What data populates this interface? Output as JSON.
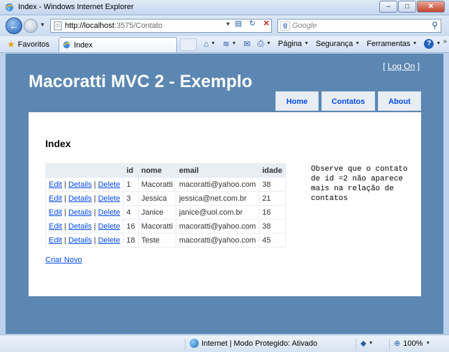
{
  "window": {
    "title": "Index - Windows Internet Explorer",
    "min": "–",
    "max": "□",
    "close": "✕"
  },
  "address": {
    "url_host": "http://localhost",
    "url_rest": ":3575/Contato",
    "search_placeholder": "Google",
    "search_logo": "g"
  },
  "toolbar": {
    "favorites": "Favoritos",
    "tab_title": "Index",
    "pagina": "Página",
    "seguranca": "Segurança",
    "ferramentas": "Ferramentas",
    "help": "?"
  },
  "site": {
    "login_open": "[",
    "login_label": "Log On",
    "login_close": "]",
    "title": "Macoratti MVC 2 - Exemplo",
    "menu": {
      "home": "Home",
      "contatos": "Contatos",
      "about": "About"
    }
  },
  "page": {
    "heading": "Index",
    "columns": [
      "",
      "id",
      "nome",
      "email",
      "idade"
    ],
    "action_labels": {
      "edit": "Edit",
      "details": "Details",
      "delete": "Delete",
      "sep": "|"
    },
    "rows": [
      {
        "id": "1",
        "nome": "Macoratti",
        "email": "macoratti@yahoo.com",
        "idade": "38"
      },
      {
        "id": "3",
        "nome": "Jessica",
        "email": "jessica@net.com.br",
        "idade": "21"
      },
      {
        "id": "4",
        "nome": "Janice",
        "email": "janice@uol.com.br",
        "idade": "16"
      },
      {
        "id": "16",
        "nome": "Macoratti",
        "email": "macoratti@yahoo.com",
        "idade": "38"
      },
      {
        "id": "18",
        "nome": "Teste",
        "email": "macoratti@yahoo.com",
        "idade": "45"
      }
    ],
    "note": "Observe que o contato de id =2 não aparece mais na relação de contatos",
    "create_link": "Criar Novo"
  },
  "status": {
    "zone": "Internet | Modo Protegido: Ativado",
    "zoom": "100%"
  },
  "colors": {
    "page_bg": "#5c87b2",
    "link": "#034af3",
    "menu_bg": "#e8eef4"
  }
}
